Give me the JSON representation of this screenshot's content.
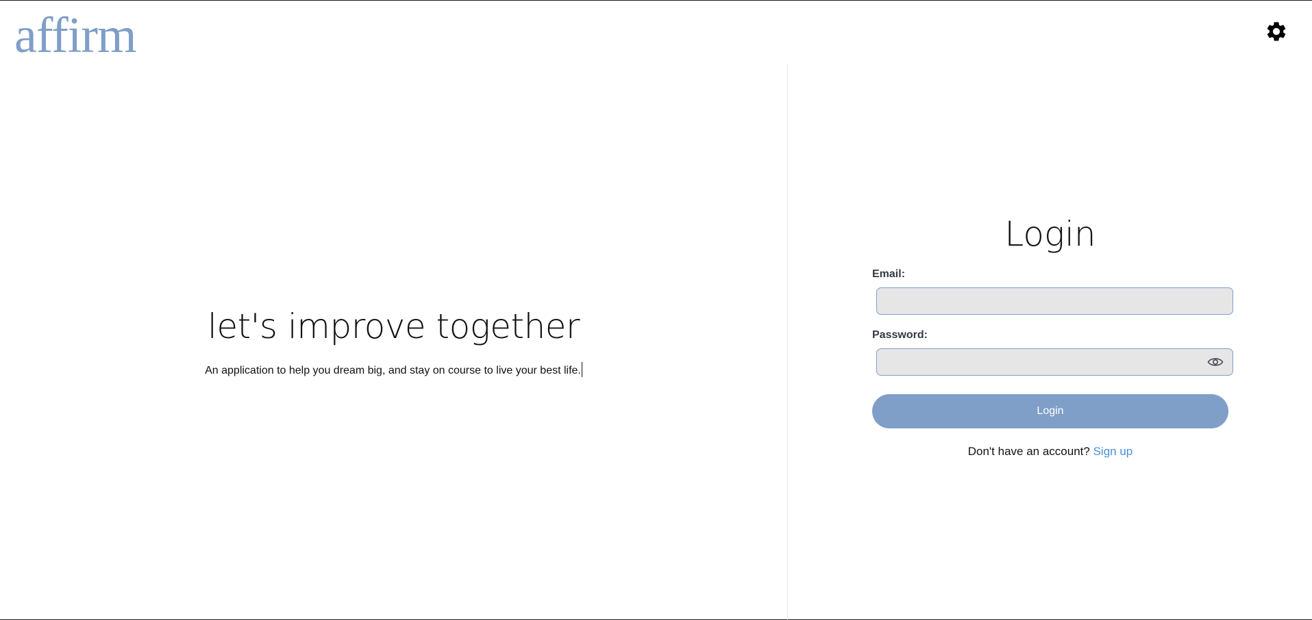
{
  "brand": {
    "logo_text": "affirm",
    "accent_color": "#7f9ec8",
    "link_color": "#4a8ed8"
  },
  "header": {
    "settings_icon": "gear-icon"
  },
  "hero": {
    "title": "let's improve together",
    "subtitle": "An application to help you dream big, and stay on course to live your best life."
  },
  "login": {
    "title": "Login",
    "email_label": "Email:",
    "email_value": "",
    "password_label": "Password:",
    "password_value": "",
    "password_toggle_icon": "eye-icon",
    "submit_label": "Login",
    "signup_prompt": "Don't have an account?",
    "signup_link": "Sign up"
  }
}
